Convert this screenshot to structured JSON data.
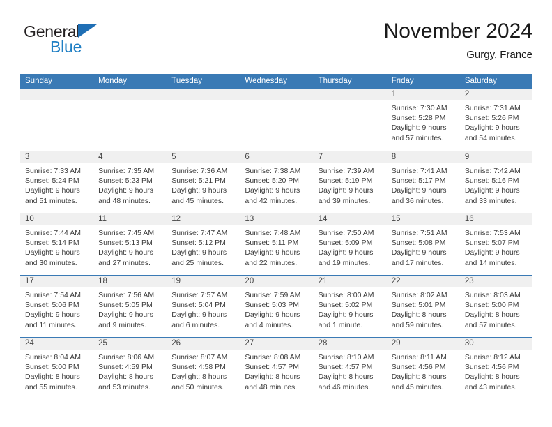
{
  "logo": {
    "primary_text": "General",
    "secondary_text": "Blue",
    "primary_color": "#231f20",
    "secondary_color": "#1f7fc4",
    "triangle_color": "#1f6fb5"
  },
  "header": {
    "title": "November 2024",
    "location": "Gurgy, France"
  },
  "theme": {
    "header_bg": "#3a7ab5",
    "header_text": "#ffffff",
    "day_band_bg": "#f0f0f0",
    "grid_line": "#3a7ab5",
    "body_text": "#3c3c3c"
  },
  "calendar": {
    "weekdays": [
      "Sunday",
      "Monday",
      "Tuesday",
      "Wednesday",
      "Thursday",
      "Friday",
      "Saturday"
    ],
    "weeks": [
      [
        {
          "day": "",
          "empty": true
        },
        {
          "day": "",
          "empty": true
        },
        {
          "day": "",
          "empty": true
        },
        {
          "day": "",
          "empty": true
        },
        {
          "day": "",
          "empty": true
        },
        {
          "day": "1",
          "sunrise": "Sunrise: 7:30 AM",
          "sunset": "Sunset: 5:28 PM",
          "daylight_line1": "Daylight: 9 hours",
          "daylight_line2": "and 57 minutes."
        },
        {
          "day": "2",
          "sunrise": "Sunrise: 7:31 AM",
          "sunset": "Sunset: 5:26 PM",
          "daylight_line1": "Daylight: 9 hours",
          "daylight_line2": "and 54 minutes."
        }
      ],
      [
        {
          "day": "3",
          "sunrise": "Sunrise: 7:33 AM",
          "sunset": "Sunset: 5:24 PM",
          "daylight_line1": "Daylight: 9 hours",
          "daylight_line2": "and 51 minutes."
        },
        {
          "day": "4",
          "sunrise": "Sunrise: 7:35 AM",
          "sunset": "Sunset: 5:23 PM",
          "daylight_line1": "Daylight: 9 hours",
          "daylight_line2": "and 48 minutes."
        },
        {
          "day": "5",
          "sunrise": "Sunrise: 7:36 AM",
          "sunset": "Sunset: 5:21 PM",
          "daylight_line1": "Daylight: 9 hours",
          "daylight_line2": "and 45 minutes."
        },
        {
          "day": "6",
          "sunrise": "Sunrise: 7:38 AM",
          "sunset": "Sunset: 5:20 PM",
          "daylight_line1": "Daylight: 9 hours",
          "daylight_line2": "and 42 minutes."
        },
        {
          "day": "7",
          "sunrise": "Sunrise: 7:39 AM",
          "sunset": "Sunset: 5:19 PM",
          "daylight_line1": "Daylight: 9 hours",
          "daylight_line2": "and 39 minutes."
        },
        {
          "day": "8",
          "sunrise": "Sunrise: 7:41 AM",
          "sunset": "Sunset: 5:17 PM",
          "daylight_line1": "Daylight: 9 hours",
          "daylight_line2": "and 36 minutes."
        },
        {
          "day": "9",
          "sunrise": "Sunrise: 7:42 AM",
          "sunset": "Sunset: 5:16 PM",
          "daylight_line1": "Daylight: 9 hours",
          "daylight_line2": "and 33 minutes."
        }
      ],
      [
        {
          "day": "10",
          "sunrise": "Sunrise: 7:44 AM",
          "sunset": "Sunset: 5:14 PM",
          "daylight_line1": "Daylight: 9 hours",
          "daylight_line2": "and 30 minutes."
        },
        {
          "day": "11",
          "sunrise": "Sunrise: 7:45 AM",
          "sunset": "Sunset: 5:13 PM",
          "daylight_line1": "Daylight: 9 hours",
          "daylight_line2": "and 27 minutes."
        },
        {
          "day": "12",
          "sunrise": "Sunrise: 7:47 AM",
          "sunset": "Sunset: 5:12 PM",
          "daylight_line1": "Daylight: 9 hours",
          "daylight_line2": "and 25 minutes."
        },
        {
          "day": "13",
          "sunrise": "Sunrise: 7:48 AM",
          "sunset": "Sunset: 5:11 PM",
          "daylight_line1": "Daylight: 9 hours",
          "daylight_line2": "and 22 minutes."
        },
        {
          "day": "14",
          "sunrise": "Sunrise: 7:50 AM",
          "sunset": "Sunset: 5:09 PM",
          "daylight_line1": "Daylight: 9 hours",
          "daylight_line2": "and 19 minutes."
        },
        {
          "day": "15",
          "sunrise": "Sunrise: 7:51 AM",
          "sunset": "Sunset: 5:08 PM",
          "daylight_line1": "Daylight: 9 hours",
          "daylight_line2": "and 17 minutes."
        },
        {
          "day": "16",
          "sunrise": "Sunrise: 7:53 AM",
          "sunset": "Sunset: 5:07 PM",
          "daylight_line1": "Daylight: 9 hours",
          "daylight_line2": "and 14 minutes."
        }
      ],
      [
        {
          "day": "17",
          "sunrise": "Sunrise: 7:54 AM",
          "sunset": "Sunset: 5:06 PM",
          "daylight_line1": "Daylight: 9 hours",
          "daylight_line2": "and 11 minutes."
        },
        {
          "day": "18",
          "sunrise": "Sunrise: 7:56 AM",
          "sunset": "Sunset: 5:05 PM",
          "daylight_line1": "Daylight: 9 hours",
          "daylight_line2": "and 9 minutes."
        },
        {
          "day": "19",
          "sunrise": "Sunrise: 7:57 AM",
          "sunset": "Sunset: 5:04 PM",
          "daylight_line1": "Daylight: 9 hours",
          "daylight_line2": "and 6 minutes."
        },
        {
          "day": "20",
          "sunrise": "Sunrise: 7:59 AM",
          "sunset": "Sunset: 5:03 PM",
          "daylight_line1": "Daylight: 9 hours",
          "daylight_line2": "and 4 minutes."
        },
        {
          "day": "21",
          "sunrise": "Sunrise: 8:00 AM",
          "sunset": "Sunset: 5:02 PM",
          "daylight_line1": "Daylight: 9 hours",
          "daylight_line2": "and 1 minute."
        },
        {
          "day": "22",
          "sunrise": "Sunrise: 8:02 AM",
          "sunset": "Sunset: 5:01 PM",
          "daylight_line1": "Daylight: 8 hours",
          "daylight_line2": "and 59 minutes."
        },
        {
          "day": "23",
          "sunrise": "Sunrise: 8:03 AM",
          "sunset": "Sunset: 5:00 PM",
          "daylight_line1": "Daylight: 8 hours",
          "daylight_line2": "and 57 minutes."
        }
      ],
      [
        {
          "day": "24",
          "sunrise": "Sunrise: 8:04 AM",
          "sunset": "Sunset: 5:00 PM",
          "daylight_line1": "Daylight: 8 hours",
          "daylight_line2": "and 55 minutes."
        },
        {
          "day": "25",
          "sunrise": "Sunrise: 8:06 AM",
          "sunset": "Sunset: 4:59 PM",
          "daylight_line1": "Daylight: 8 hours",
          "daylight_line2": "and 53 minutes."
        },
        {
          "day": "26",
          "sunrise": "Sunrise: 8:07 AM",
          "sunset": "Sunset: 4:58 PM",
          "daylight_line1": "Daylight: 8 hours",
          "daylight_line2": "and 50 minutes."
        },
        {
          "day": "27",
          "sunrise": "Sunrise: 8:08 AM",
          "sunset": "Sunset: 4:57 PM",
          "daylight_line1": "Daylight: 8 hours",
          "daylight_line2": "and 48 minutes."
        },
        {
          "day": "28",
          "sunrise": "Sunrise: 8:10 AM",
          "sunset": "Sunset: 4:57 PM",
          "daylight_line1": "Daylight: 8 hours",
          "daylight_line2": "and 46 minutes."
        },
        {
          "day": "29",
          "sunrise": "Sunrise: 8:11 AM",
          "sunset": "Sunset: 4:56 PM",
          "daylight_line1": "Daylight: 8 hours",
          "daylight_line2": "and 45 minutes."
        },
        {
          "day": "30",
          "sunrise": "Sunrise: 8:12 AM",
          "sunset": "Sunset: 4:56 PM",
          "daylight_line1": "Daylight: 8 hours",
          "daylight_line2": "and 43 minutes."
        }
      ]
    ]
  }
}
